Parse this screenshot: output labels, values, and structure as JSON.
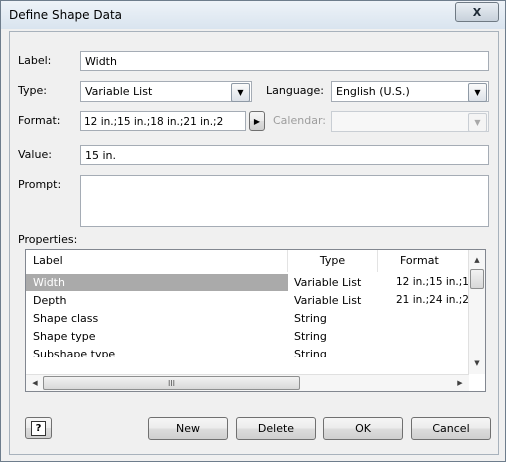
{
  "window": {
    "title": "Define Shape Data",
    "close_glyph": "X"
  },
  "form": {
    "label_label": "Label:",
    "label_value": "Width",
    "type_label": "Type:",
    "type_value": "Variable List",
    "language_label": "Language:",
    "language_value": "English (U.S.)",
    "format_label": "Format:",
    "format_value": "12 in.;15 in.;18 in.;21 in.;2",
    "calendar_label": "Calendar:",
    "calendar_value": "",
    "value_label": "Value:",
    "value_value": "15 in.",
    "prompt_label": "Prompt:",
    "prompt_value": ""
  },
  "properties": {
    "label": "Properties:",
    "columns": [
      "Label",
      "Type",
      "Format"
    ],
    "rows": [
      {
        "label": "Width",
        "type": "Variable List",
        "format": "12 in.;15 in.;1",
        "selected": true
      },
      {
        "label": "Depth",
        "type": "Variable List",
        "format": "21 in.;24 in.;2",
        "selected": false
      },
      {
        "label": "Shape class",
        "type": "String",
        "format": "",
        "selected": false
      },
      {
        "label": "Shape type",
        "type": "String",
        "format": "",
        "selected": false
      },
      {
        "label": "Subshape type",
        "type": "String",
        "format": "",
        "selected": false
      }
    ],
    "hscroll_thumb_glyph": "III"
  },
  "buttons": {
    "help": "?",
    "new": "New",
    "delete": "Delete",
    "ok": "OK",
    "cancel": "Cancel"
  },
  "icons": {
    "dropdown": "chevron-down-icon",
    "format_arrow": "chevron-right-icon",
    "help": "help-icon"
  },
  "colors": {
    "selected_row_bg": "#aaaaaa",
    "dialog_bg": "#f0f0f0",
    "title_bar": "#dde6ef"
  }
}
